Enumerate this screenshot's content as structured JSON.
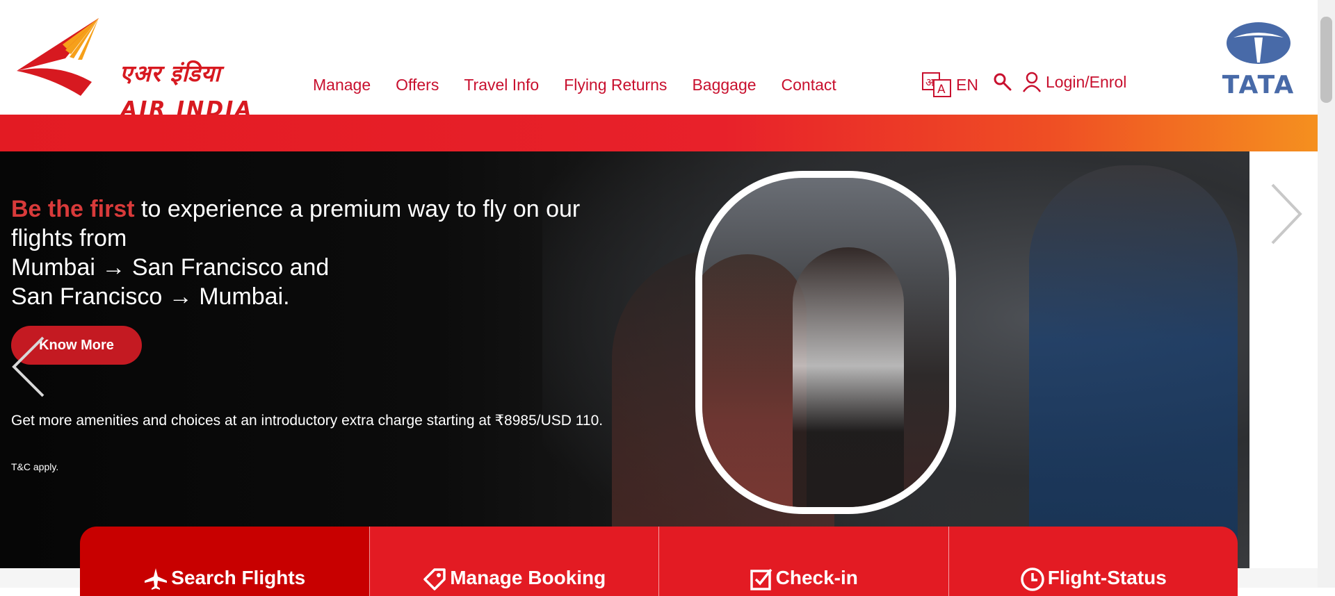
{
  "header": {
    "logo_hindi": "एअर इंडिया",
    "logo_english": "AIR INDIA",
    "nav": [
      "Manage",
      "Offers",
      "Travel Info",
      "Flying Returns",
      "Baggage",
      "Contact"
    ],
    "language": "EN",
    "login_label": "Login/Enrol",
    "partner_logo": "TATA"
  },
  "hero": {
    "headline_accent": "Be the first",
    "headline_rest": " to experience a premium way to fly on our flights from",
    "route_line1": "Mumbai → San Francisco and",
    "route_line2": "San Francisco → Mumbai.",
    "cta_label": "Know More",
    "amenities_text": "Get more amenities and choices at an introductory extra charge starting at ₹8985/USD 110.",
    "tnc": "T&C apply."
  },
  "tabs": [
    {
      "label": "Search Flights",
      "icon": "plane-icon"
    },
    {
      "label": "Manage Booking",
      "icon": "tag-icon"
    },
    {
      "label": "Check-in",
      "icon": "checkbox-icon"
    },
    {
      "label": "Flight-Status",
      "icon": "clock-icon"
    }
  ],
  "colors": {
    "brand_red": "#c8102e",
    "tab_red": "#e31b23",
    "tab_active": "#c80000",
    "tata_blue": "#486aa8"
  }
}
